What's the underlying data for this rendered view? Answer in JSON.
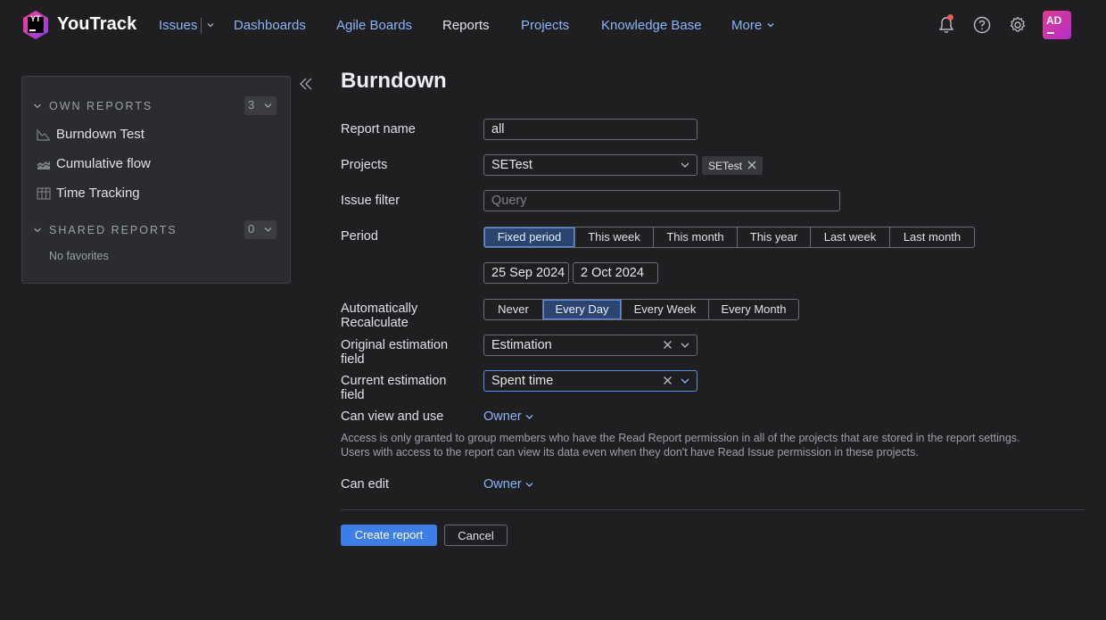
{
  "header": {
    "logo_text": "YT",
    "brand": "YouTrack",
    "nav": {
      "issues": "Issues",
      "dashboards": "Dashboards",
      "agile_boards": "Agile Boards",
      "reports": "Reports",
      "projects": "Projects",
      "knowledge_base": "Knowledge Base",
      "more": "More"
    },
    "avatar_initials": "AD",
    "icons": [
      "bell-icon",
      "help-icon",
      "gear-icon"
    ],
    "colors": {
      "link": "#8ab4f8",
      "accent": "#3d7de8",
      "notification": "#e55b5b"
    }
  },
  "sidebar": {
    "own_reports": {
      "title": "OWN REPORTS",
      "count": "3"
    },
    "items": [
      {
        "label": "Burndown Test",
        "icon": "burndown-chart-icon"
      },
      {
        "label": "Cumulative flow",
        "icon": "cumulative-flow-icon"
      },
      {
        "label": "Time Tracking",
        "icon": "table-icon"
      }
    ],
    "shared_reports": {
      "title": "SHARED REPORTS",
      "count": "0"
    },
    "no_favorites": "No favorites"
  },
  "form": {
    "title": "Burndown",
    "report_name": {
      "label": "Report name",
      "value": "all"
    },
    "projects": {
      "label": "Projects",
      "value": "SETest",
      "tag": "SETest"
    },
    "issue_filter": {
      "label": "Issue filter",
      "placeholder": "Query"
    },
    "period": {
      "label": "Period",
      "options": [
        "Fixed period",
        "This week",
        "This month",
        "This year",
        "Last week",
        "Last month"
      ],
      "selected": "Fixed period",
      "start_date": "25 Sep 2024",
      "end_date": "2 Oct 2024"
    },
    "recalculate": {
      "label": "Automatically Recalculate",
      "options": [
        "Never",
        "Every Day",
        "Every Week",
        "Every Month"
      ],
      "selected": "Every Day"
    },
    "original_estimation": {
      "label": "Original estimation field",
      "value": "Estimation"
    },
    "current_estimation": {
      "label": "Current estimation field",
      "value": "Spent time"
    },
    "can_view": {
      "label": "Can view and use",
      "value": "Owner"
    },
    "help_line1": "Access is only granted to group members who have the Read Report permission in all of the projects that are stored in the report settings.",
    "help_line2": "Users with access to the report can view its data even when they don't have Read Issue permission in these projects.",
    "can_edit": {
      "label": "Can edit",
      "value": "Owner"
    },
    "create_button": "Create report",
    "cancel_button": "Cancel"
  }
}
